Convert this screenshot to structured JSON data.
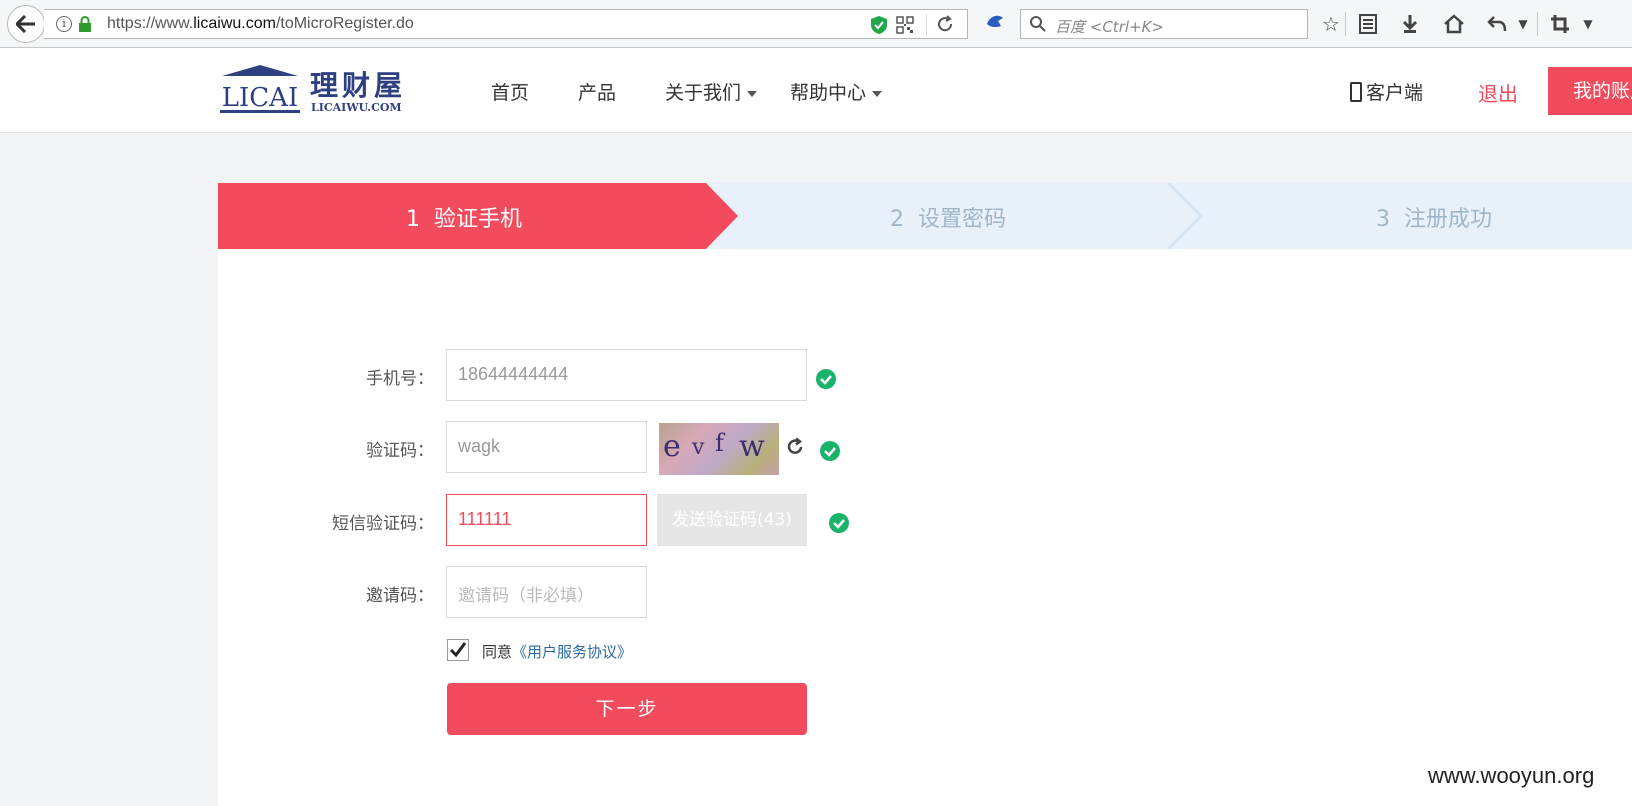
{
  "browser": {
    "url_prefix": "https://www.",
    "url_domain": "licaiwu.com",
    "url_path": "/toMicroRegister.do",
    "search_placeholder": "百度 <Ctrl+K>"
  },
  "header": {
    "logo_text": "LICAI",
    "logo_cn": "理财屋",
    "logo_sub": "LICAIWU.COM",
    "nav": [
      "首页",
      "产品",
      "关于我们",
      "帮助中心"
    ],
    "client": "客户端",
    "logout": "退出",
    "account": "我的账户"
  },
  "steps": [
    {
      "num": "1",
      "label": "验证手机"
    },
    {
      "num": "2",
      "label": "设置密码"
    },
    {
      "num": "3",
      "label": "注册成功"
    }
  ],
  "form": {
    "phone_label": "手机号：",
    "phone_value": "18644444444",
    "captcha_label": "验证码：",
    "captcha_value": "wagk",
    "captcha_chars": [
      "e",
      "v",
      "f",
      "w"
    ],
    "sms_label": "短信验证码：",
    "sms_value": "111111",
    "sms_button": "发送验证码(43)",
    "invite_label": "邀请码：",
    "invite_placeholder": "邀请码（非必填）",
    "agree_text": "同意",
    "agree_link": "《用户服务协议》",
    "next_button": "下一步"
  },
  "colors": {
    "accent": "#f24b5d",
    "success": "#1ab36a",
    "step_bg": "#e8f1fa",
    "step_inactive_text": "#9fb6c9"
  },
  "watermark": "www.wooyun.org"
}
